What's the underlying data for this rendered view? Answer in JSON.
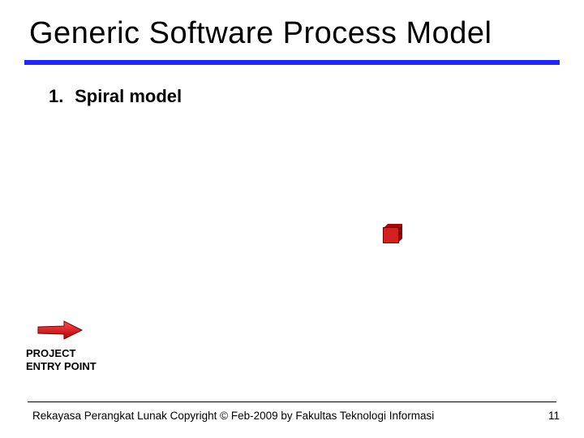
{
  "title": "Generic Software Process Model",
  "list": {
    "number": "1.",
    "text": "Spiral model"
  },
  "entry_label": "PROJECT\nENTRY POINT",
  "footer": "Rekayasa Perangkat Lunak Copyright © Feb-2009 by Fakultas Teknologi Informasi",
  "page_number": "11",
  "colors": {
    "rule": "#2424ff",
    "accent": "#d62020"
  }
}
